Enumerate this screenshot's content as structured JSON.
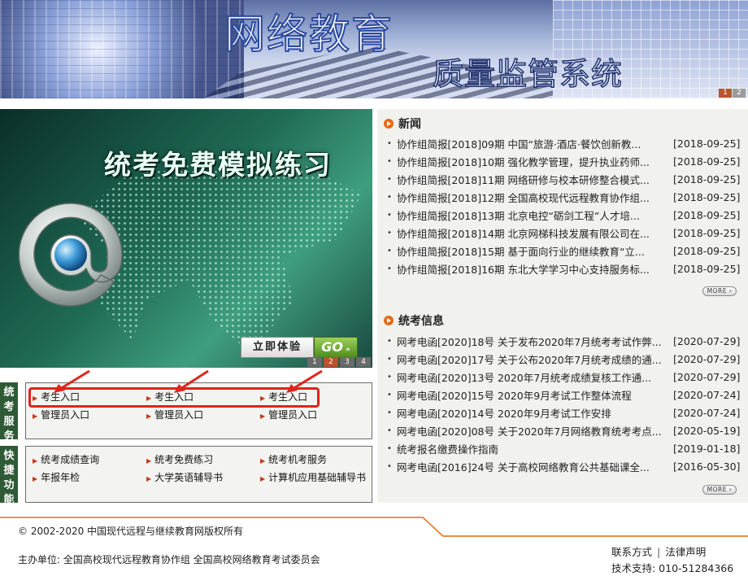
{
  "header": {
    "title_main": "网络教育",
    "title_sub": "质量监管系统",
    "pager": [
      "1",
      "2"
    ]
  },
  "promo": {
    "title": "统考免费模拟练习",
    "try_label": "立即体验",
    "go_label": "GO",
    "pager": [
      "1",
      "2",
      "3",
      "4"
    ]
  },
  "exam_service": {
    "tab": "统考服务",
    "row1": [
      "考生入口",
      "考生入口",
      "考生入口"
    ],
    "row2": [
      "管理员入口",
      "管理员入口",
      "管理员入口"
    ]
  },
  "quick": {
    "tab": "快捷功能",
    "row1": [
      "统考成绩查询",
      "统考免费练习",
      "统考机考服务"
    ],
    "row2": [
      "年报年检",
      "大学英语辅导书",
      "计算机应用基础辅导书"
    ]
  },
  "news": {
    "title": "新闻",
    "items": [
      {
        "text": "协作组简报[2018]09期 中国“旅游·酒店·餐饮创新教...",
        "date": "[2018-09-25]"
      },
      {
        "text": "协作组简报[2018]10期 强化教学管理，提升执业药师...",
        "date": "[2018-09-25]"
      },
      {
        "text": "协作组简报[2018]11期 网络研修与校本研修整合模式...",
        "date": "[2018-09-25]"
      },
      {
        "text": "协作组简报[2018]12期 全国高校现代远程教育协作组...",
        "date": "[2018-09-25]"
      },
      {
        "text": "协作组简报[2018]13期 北京电控“砺剑工程”人才培...",
        "date": "[2018-09-25]"
      },
      {
        "text": "协作组简报[2018]14期 北京网梯科技发展有限公司在...",
        "date": "[2018-09-25]"
      },
      {
        "text": "协作组简报[2018]15期 基于面向行业的继续教育“立...",
        "date": "[2018-09-25]"
      },
      {
        "text": "协作组简报[2018]16期 东北大学学习中心支持服务标...",
        "date": "[2018-09-25]"
      }
    ],
    "more": "MORE"
  },
  "exam_info": {
    "title": "统考信息",
    "items": [
      {
        "text": "网考电函[2020]18号 关于发布2020年7月统考考试作弊...",
        "date": "[2020-07-29]"
      },
      {
        "text": "网考电函[2020]17号 关于公布2020年7月统考成绩的通...",
        "date": "[2020-07-29]"
      },
      {
        "text": "网考电函[2020]13号 2020年7月统考成绩复核工作通...",
        "date": "[2020-07-29]"
      },
      {
        "text": "网考电函[2020]15号 2020年9月考试工作整体流程",
        "date": "[2020-07-24]"
      },
      {
        "text": "网考电函[2020]14号 2020年9月考试工作安排",
        "date": "[2020-07-24]"
      },
      {
        "text": "网考电函[2020]08号 关于2020年7月网络教育统考考点...",
        "date": "[2020-05-19]"
      },
      {
        "text": "统考报名缴费操作指南",
        "date": "[2019-01-18]"
      },
      {
        "text": "网考电函[2016]24号 关于高校网络教育公共基础课全...",
        "date": "[2016-05-30]"
      }
    ],
    "more": "MORE"
  },
  "footer": {
    "copyright": "© 2002-2020 中国现代远程与继续教育网版权所有",
    "sponsor": "主办单位:  全国高校现代远程教育协作组 全国高校网络教育考试委员会",
    "contact": "联系方式",
    "legal": "法律声明",
    "support": "技术支持:  010-51284366"
  },
  "colors": {
    "accent_orange": "#e56a12",
    "highlight_red": "#e0241d",
    "side_tab_green": "#2f5a36"
  }
}
